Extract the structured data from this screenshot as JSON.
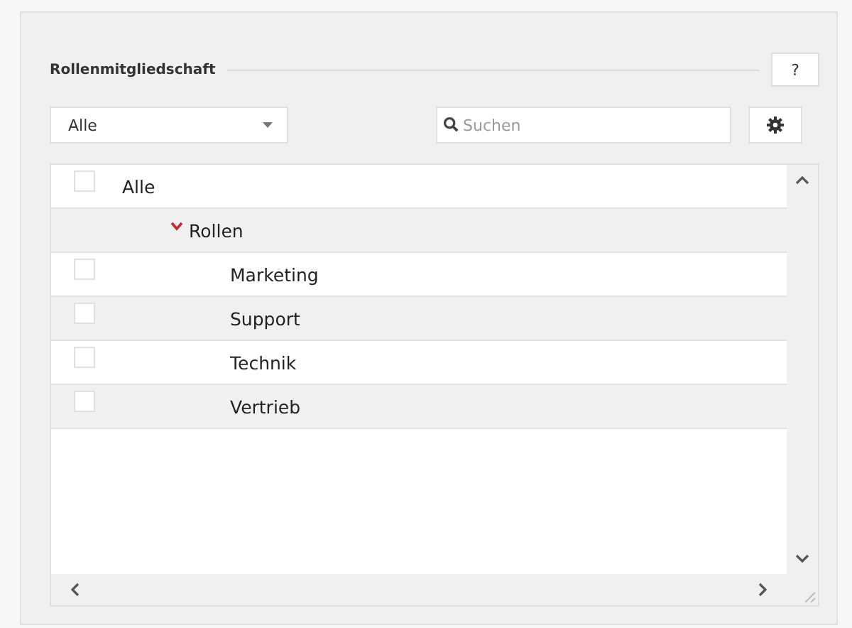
{
  "section": {
    "title": "Rollenmitgliedschaft",
    "help_button": "?"
  },
  "filter": {
    "value": "Alle"
  },
  "search": {
    "placeholder": "Suchen"
  },
  "tree": [
    {
      "kind": "item",
      "label": "Alle",
      "checked": false,
      "children": [
        {
          "kind": "group",
          "label": "Rollen",
          "expanded": true,
          "children": [
            {
              "kind": "item",
              "label": "Marketing",
              "checked": false
            },
            {
              "kind": "item",
              "label": "Support",
              "checked": false
            },
            {
              "kind": "item",
              "label": "Technik",
              "checked": false
            },
            {
              "kind": "item",
              "label": "Vertrieb",
              "checked": false
            }
          ]
        }
      ]
    }
  ]
}
